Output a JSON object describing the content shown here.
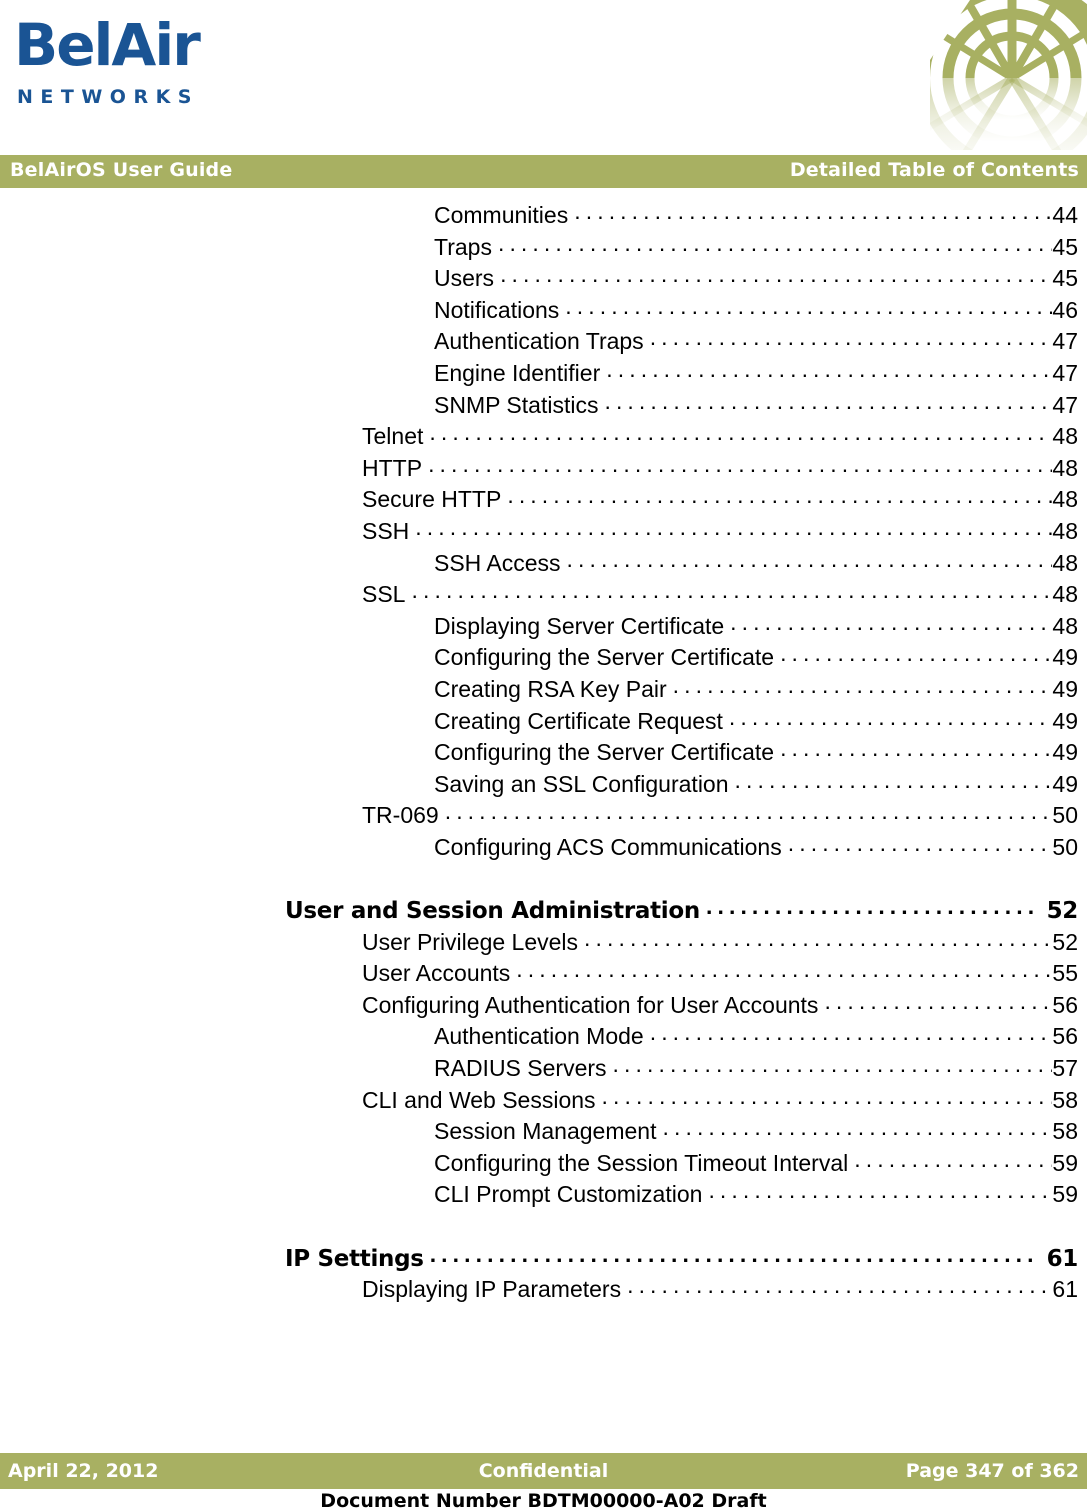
{
  "brand": {
    "logo_wordmark": "BelAir",
    "logo_subwordmark": "NETWORKS",
    "logo_color": "#1a5494",
    "corner_graphic_icon": "radial-wave-graphic",
    "accent_color": "#a8b062"
  },
  "header": {
    "left_title": "BelAirOS User Guide",
    "right_title": "Detailed Table of Contents"
  },
  "toc": {
    "entries": [
      {
        "level": 3,
        "label": "Communities",
        "page": "44"
      },
      {
        "level": 3,
        "label": "Traps",
        "page": "45"
      },
      {
        "level": 3,
        "label": "Users",
        "page": "45"
      },
      {
        "level": 3,
        "label": "Notifications",
        "page": "46"
      },
      {
        "level": 3,
        "label": "Authentication Traps",
        "page": "47"
      },
      {
        "level": 3,
        "label": "Engine Identifier",
        "page": "47"
      },
      {
        "level": 3,
        "label": "SNMP Statistics",
        "page": "47"
      },
      {
        "level": 2,
        "label": "Telnet",
        "page": "48"
      },
      {
        "level": 2,
        "label": "HTTP",
        "page": "48"
      },
      {
        "level": 2,
        "label": "Secure HTTP",
        "page": "48"
      },
      {
        "level": 2,
        "label": "SSH",
        "page": "48"
      },
      {
        "level": 3,
        "label": "SSH Access",
        "page": "48"
      },
      {
        "level": 2,
        "label": "SSL",
        "page": "48"
      },
      {
        "level": 3,
        "label": "Displaying Server Certificate",
        "page": "48"
      },
      {
        "level": 3,
        "label": "Configuring the Server Certificate",
        "page": "49"
      },
      {
        "level": 3,
        "label": "Creating RSA Key Pair",
        "page": "49"
      },
      {
        "level": 3,
        "label": "Creating Certificate Request",
        "page": "49"
      },
      {
        "level": 3,
        "label": "Configuring the Server Certificate",
        "page": "49"
      },
      {
        "level": 3,
        "label": "Saving an SSL Configuration",
        "page": "49"
      },
      {
        "level": 2,
        "label": "TR-069",
        "page": "50"
      },
      {
        "level": 3,
        "label": "Configuring ACS Communications",
        "page": "50"
      },
      {
        "level": 0,
        "label": "",
        "page": ""
      },
      {
        "level": 1,
        "label": "User and Session Administration",
        "page": "52"
      },
      {
        "level": 2,
        "label": "User Privilege Levels",
        "page": "52"
      },
      {
        "level": 2,
        "label": "User Accounts",
        "page": "55"
      },
      {
        "level": 2,
        "label": "Configuring Authentication for User Accounts",
        "page": "56"
      },
      {
        "level": 3,
        "label": "Authentication Mode",
        "page": "56"
      },
      {
        "level": 3,
        "label": "RADIUS Servers",
        "page": "57"
      },
      {
        "level": 2,
        "label": "CLI and Web Sessions",
        "page": "58"
      },
      {
        "level": 3,
        "label": "Session Management",
        "page": "58"
      },
      {
        "level": 3,
        "label": "Configuring the Session Timeout Interval",
        "page": "59"
      },
      {
        "level": 3,
        "label": "CLI Prompt Customization",
        "page": "59"
      },
      {
        "level": 0,
        "label": "",
        "page": ""
      },
      {
        "level": 1,
        "label": "IP Settings",
        "page": "61"
      },
      {
        "level": 2,
        "label": "Displaying IP Parameters",
        "page": "61"
      }
    ],
    "leader_char": "."
  },
  "footer": {
    "date": "April 22, 2012",
    "classification": "Confidential",
    "page_indicator": "Page 347 of 362",
    "document_number": "Document Number BDTM00000-A02 Draft"
  }
}
